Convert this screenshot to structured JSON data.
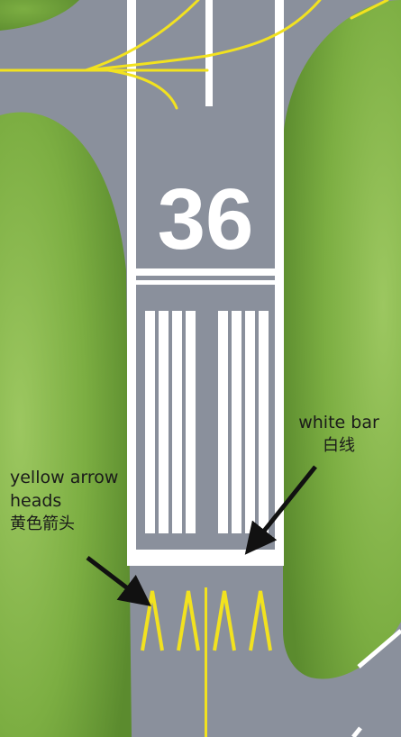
{
  "runway": {
    "designator": "36"
  },
  "annotations": {
    "white_bar": {
      "en": "white bar",
      "cn": "白线"
    },
    "yellow_arrow_heads": {
      "en_line1": "yellow arrow",
      "en_line2": "heads",
      "cn": "黄色箭头"
    }
  },
  "colors": {
    "pavement": "#8a909c",
    "grass_light": "#8cbc4e",
    "grass_dark": "#5b8b2e",
    "runway_marking": "#ffffff",
    "taxiway_marking": "#f2e21f",
    "annotation_arrow": "#111111"
  }
}
